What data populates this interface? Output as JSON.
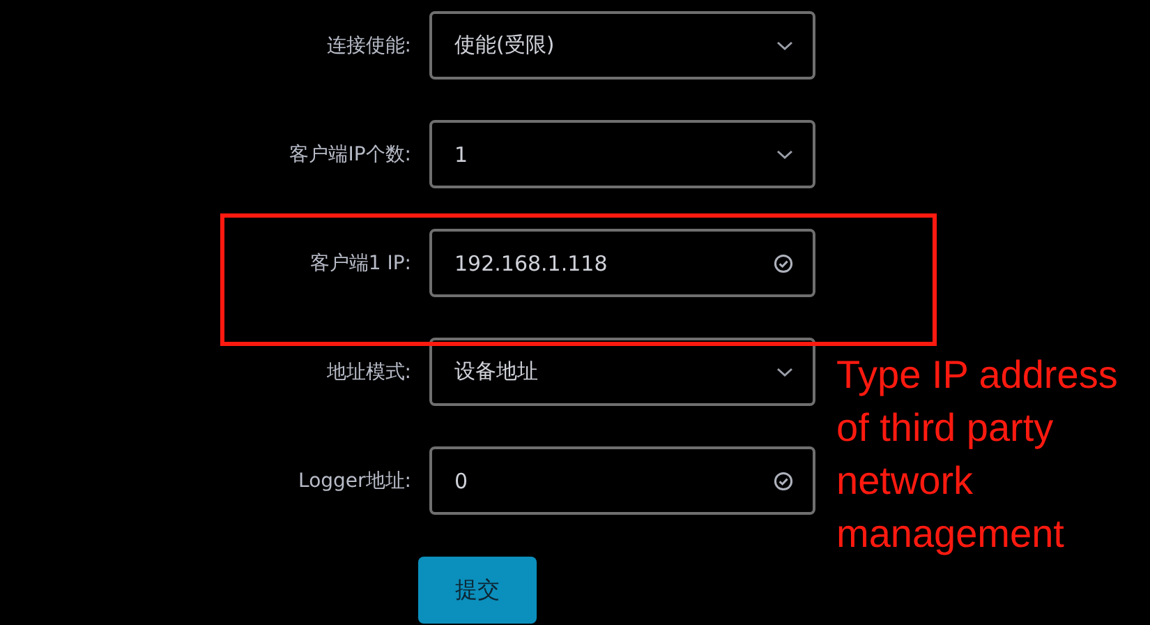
{
  "form": {
    "rows": [
      {
        "label": "连接使能:",
        "kind": "select",
        "value": "使能(受限)",
        "highlighted": false
      },
      {
        "label": "客户端IP个数:",
        "kind": "select",
        "value": "1",
        "highlighted": false
      },
      {
        "label": "客户端1 IP:",
        "kind": "input",
        "value": "192.168.1.118",
        "highlighted": true
      },
      {
        "label": "地址模式:",
        "kind": "select",
        "value": "设备地址",
        "highlighted": false
      },
      {
        "label": "Logger地址:",
        "kind": "input",
        "value": "0",
        "highlighted": false
      }
    ],
    "submit_button": "提交"
  },
  "annotation": {
    "text": "Type IP address of third party network management"
  }
}
